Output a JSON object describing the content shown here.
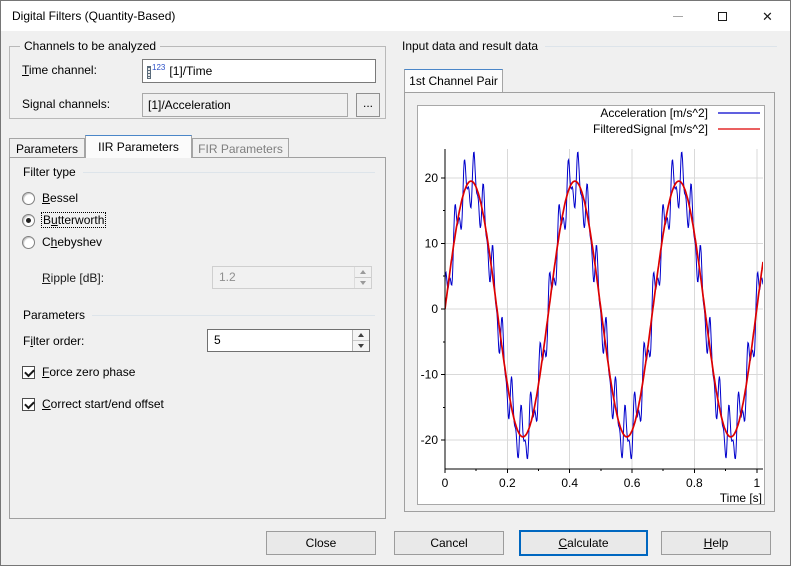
{
  "window": {
    "title": "Digital Filters (Quantity-Based)",
    "close_glyph": "✕"
  },
  "channels": {
    "group_title": "Channels to be analyzed",
    "time_channel_label": "Time channel:",
    "time_channel_value": "[1]/Time",
    "time_channel_icon": "numeric-ruler-123-icon",
    "time_channel_icon_text": "123",
    "signal_channels_label": "Signal channels:",
    "signal_channels_value": "[1]/Acceleration",
    "browse_button_label": "..."
  },
  "tabs": {
    "parameters": "Parameters",
    "iir": "IIR Parameters",
    "fir": "FIR Parameters",
    "selected": "IIR Parameters",
    "disabled": "FIR Parameters"
  },
  "iir_panel": {
    "filter_type_title": "Filter type",
    "radio_bessel": "Bessel",
    "radio_butterworth": "Butterworth",
    "radio_chebyshev": "Chebyshev",
    "selected_filter_type": "Butterworth",
    "ripple_label": "Ripple [dB]:",
    "ripple_value": "1.2",
    "ripple_enabled": false,
    "parameters_title": "Parameters",
    "filter_order_label": "Filter order:",
    "filter_order_value": "5",
    "checkbox_force_zero_phase_label": "Force zero phase",
    "checkbox_force_zero_phase_checked": true,
    "checkbox_correct_offset_label": "Correct start/end offset",
    "checkbox_correct_offset_checked": true
  },
  "result_area": {
    "group_title": "Input data and result data",
    "tab_label": "1st Channel Pair"
  },
  "chart_data": {
    "type": "line",
    "title": "",
    "xlabel": "Time [s]",
    "ylabel": "",
    "xlim": [
      0,
      1.02
    ],
    "ylim": [
      -24.4,
      24.4
    ],
    "x_ticks": [
      0,
      0.2,
      0.4,
      0.6,
      0.8,
      1
    ],
    "x_tick_labels": [
      "0",
      "0.2",
      "0.4",
      "0.6",
      "0.8",
      "1"
    ],
    "x_minor_step": 0.1,
    "y_ticks": [
      -20,
      -10,
      0,
      10,
      20
    ],
    "y_tick_labels": [
      "-20",
      "-10",
      "0",
      "10",
      "20"
    ],
    "y_minor_step": 5,
    "grid": true,
    "legend_position": "top-right",
    "duration_s": 1.02,
    "series": [
      {
        "name": "Acceleration [m/s^2]",
        "color": "#0000cc",
        "line_width": 1,
        "sample_rate_hz": 600,
        "signal": {
          "base_amplitude": 19.5,
          "base_frequency_hz": 3,
          "ripple_components": [
            {
              "amplitude": 3.4,
              "frequency_hz": 33,
              "phase_rad": 0.8
            },
            {
              "amplitude": 1.8,
              "frequency_hz": 66,
              "phase_rad": 1.2
            }
          ]
        }
      },
      {
        "name": "FilteredSignal [m/s^2]",
        "color": "#dd0000",
        "line_width": 1.7,
        "sample_rate_hz": 600,
        "signal": {
          "base_amplitude": 19.5,
          "base_frequency_hz": 3,
          "ripple_components": []
        }
      }
    ]
  },
  "footer": {
    "close": "Close",
    "cancel": "Cancel",
    "calculate": "Calculate",
    "help": "Help"
  },
  "colors": {
    "accent": "#0067c0",
    "acceleration_series": "#0000cc",
    "filtered_series": "#dd0000",
    "grid": "#d9d9d9",
    "disabled_text": "#8f8f8f"
  }
}
